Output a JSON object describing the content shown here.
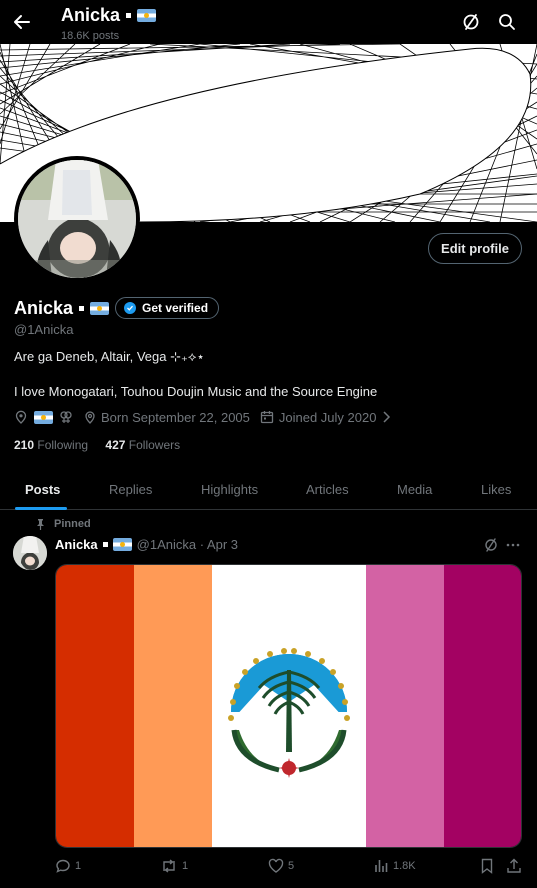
{
  "header": {
    "name": "Anicka",
    "posts_count": "18.6K posts"
  },
  "profile": {
    "display_name": "Anicka",
    "verify_label": "Get verified",
    "handle": "@1Anicka",
    "edit_label": "Edit profile",
    "bio_line1": "Are ga Deneb, Altair, Vega ⊹₊⟡⋆",
    "bio_line2": "I love Monogatari, Touhou Doujin Music and the Source Engine",
    "born": "Born September 22, 2005",
    "joined": "Joined July 2020",
    "following_count": "210",
    "following_label": "Following",
    "followers_count": "427",
    "followers_label": "Followers"
  },
  "tabs": [
    "Posts",
    "Replies",
    "Highlights",
    "Articles",
    "Media",
    "Likes"
  ],
  "post": {
    "pinned_label": "Pinned",
    "author": "Anicka",
    "handle_date": "@1Anicka · Apr 3",
    "replies": "1",
    "reposts": "1",
    "likes": "5",
    "views": "1.8K"
  },
  "colors": {
    "accent": "#1d9bf0",
    "flag_stripes": [
      "#d52d00",
      "#ff9a56",
      "#ffffff",
      "#d362a4",
      "#a30262"
    ]
  },
  "icons": [
    "back-arrow-icon",
    "ban-circle-icon",
    "search-icon",
    "verified-badge-icon",
    "location-pin-icon",
    "venus-mars-icon",
    "location-icon",
    "calendar-icon",
    "chevron-right-icon",
    "pin-icon",
    "more-icon",
    "reply-icon",
    "repost-icon",
    "like-icon",
    "views-icon",
    "bookmark-icon",
    "share-icon"
  ]
}
